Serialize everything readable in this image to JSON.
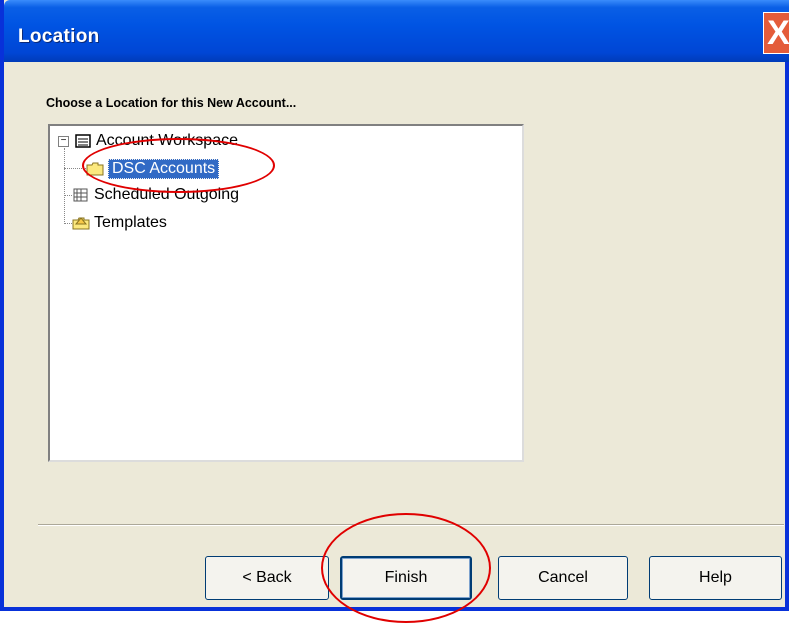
{
  "window": {
    "title": "Location",
    "close_glyph": "X"
  },
  "prompt": "Choose a Location for this New Account...",
  "tree": {
    "expander_glyph": "−",
    "items": [
      {
        "label": "Account Workspace",
        "icon": "tray-icon",
        "expanded": true
      },
      {
        "label": "DSC Accounts",
        "icon": "folder-icon",
        "selected": true
      },
      {
        "label": "Scheduled Outgoing",
        "icon": "scheduled-icon"
      },
      {
        "label": "Templates",
        "icon": "templates-folder-icon"
      }
    ]
  },
  "buttons": {
    "back": "< Back",
    "finish": "Finish",
    "cancel": "Cancel",
    "help": "Help"
  },
  "colors": {
    "accent": "#0054e3",
    "selection": "#316ac5",
    "annotation": "#e00000"
  }
}
